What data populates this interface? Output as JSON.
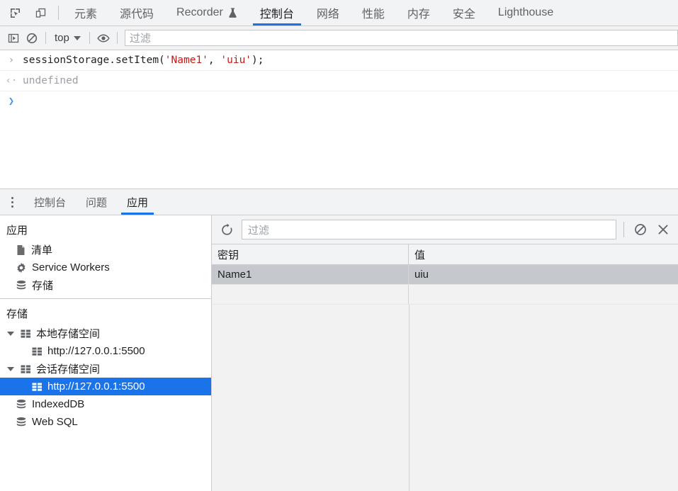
{
  "topbar": {
    "icons": [
      {
        "name": "inspect-element-icon",
        "title": "检查元素"
      },
      {
        "name": "device-toolbar-icon",
        "title": "切换设备工具栏"
      }
    ],
    "tabs": [
      {
        "label": "元素",
        "active": false,
        "flask": false
      },
      {
        "label": "源代码",
        "active": false,
        "flask": false
      },
      {
        "label": "Recorder",
        "active": false,
        "flask": true
      },
      {
        "label": "控制台",
        "active": true,
        "flask": false
      },
      {
        "label": "网络",
        "active": false,
        "flask": false
      },
      {
        "label": "性能",
        "active": false,
        "flask": false
      },
      {
        "label": "内存",
        "active": false,
        "flask": false
      },
      {
        "label": "安全",
        "active": false,
        "flask": false
      },
      {
        "label": "Lighthouse",
        "active": false,
        "flask": false
      }
    ],
    "active_underline_color": "#1a73e8"
  },
  "console_toolbar": {
    "sidebar_toggle": "console-sidebar-icon",
    "clear_console": "clear-console-icon",
    "context_label": "top",
    "eye_icon": "live-expression-icon",
    "filter_placeholder": "过滤",
    "filter_value": ""
  },
  "console": {
    "entries": [
      {
        "type": "input",
        "gutter": "›",
        "code_prefix": "sessionStorage.setItem(",
        "arg1": "'Name1'",
        "code_mid": ", ",
        "arg2": "'uiu'",
        "code_suffix": ");",
        "full_text": "sessionStorage.setItem('Name1', 'uiu');"
      },
      {
        "type": "result",
        "gutter": "‹·",
        "text": "undefined"
      }
    ],
    "prompt_gutter": "❯",
    "prompt_value": "",
    "string_color": "#c41a16",
    "result_color": "#9aa0a6"
  },
  "drawer": {
    "menu_icon": "kebab-menu-icon",
    "tabs": [
      {
        "label": "控制台",
        "active": false
      },
      {
        "label": "问题",
        "active": false
      },
      {
        "label": "应用",
        "active": true
      }
    ]
  },
  "app_sidebar": {
    "application": {
      "title": "应用",
      "items": [
        {
          "label": "清单",
          "icon": "manifest-document-icon",
          "selected": false
        },
        {
          "label": "Service Workers",
          "icon": "gear-icon",
          "selected": false
        },
        {
          "label": "存储",
          "icon": "database-icon",
          "selected": false
        }
      ]
    },
    "storage": {
      "title": "存储",
      "items": [
        {
          "label": "本地存储空间",
          "icon": "table-grid-icon",
          "expanded": true,
          "level": 0,
          "selected": false
        },
        {
          "label": "http://127.0.0.1:5500",
          "icon": "table-grid-icon",
          "expanded": null,
          "level": 1,
          "selected": false
        },
        {
          "label": "会话存储空间",
          "icon": "table-grid-icon",
          "expanded": true,
          "level": 0,
          "selected": false
        },
        {
          "label": "http://127.0.0.1:5500",
          "icon": "table-grid-icon",
          "expanded": null,
          "level": 1,
          "selected": true
        },
        {
          "label": "IndexedDB",
          "icon": "database-icon",
          "expanded": null,
          "level": 0,
          "selected": false
        },
        {
          "label": "Web SQL",
          "icon": "database-icon",
          "expanded": null,
          "level": 0,
          "selected": false
        }
      ],
      "selection_color": "#1a73e8"
    }
  },
  "storage_view": {
    "toolbar": {
      "refresh_icon": "refresh-icon",
      "filter_placeholder": "过滤",
      "filter_value": "",
      "clear_all_icon": "clear-all-icon",
      "delete_selected_icon": "delete-selected-icon"
    },
    "table": {
      "columns": [
        "密钥",
        "值"
      ],
      "rows": [
        {
          "key": "Name1",
          "value": "uiu",
          "selected": true
        },
        {
          "key": "",
          "value": "",
          "selected": false
        }
      ],
      "selected_row_color": "#c5c8cc"
    }
  }
}
